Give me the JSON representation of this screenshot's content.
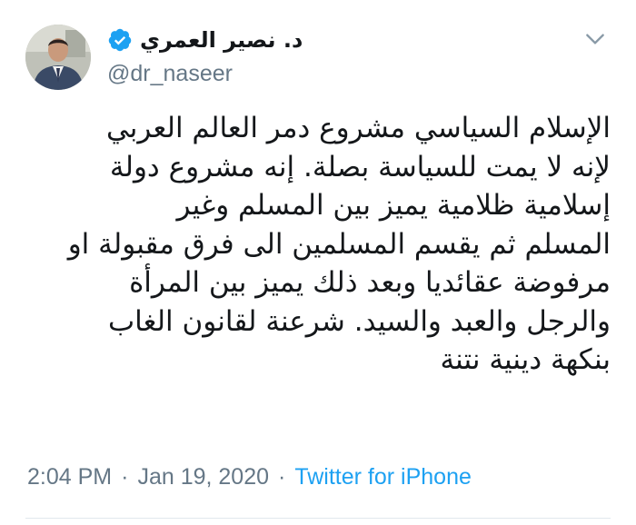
{
  "author": {
    "display_name": "د. نصير العمري",
    "handle": "@dr_naseer",
    "verified": true
  },
  "tweet": {
    "lines": [
      "الإسلام السياسي مشروع دمر العالم العربي",
      "لإنه لا يمت للسياسة بصلة. إنه مشروع دولة",
      "إسلامية ظلامية يميز بين المسلم وغير",
      "المسلم ثم يقسم المسلمين الى فرق مقبولة او",
      "مرفوضة عقائديا وبعد ذلك يميز بين المرأة",
      "والرجل والعبد والسيد. شرعنة لقانون الغاب",
      "بنكهة دينية نتنة"
    ]
  },
  "meta": {
    "time": "2:04 PM",
    "separator": "·",
    "date": "Jan 19, 2020",
    "source": "Twitter for iPhone"
  },
  "icons": {
    "verified": "verified-badge-icon",
    "menu": "chevron-down-icon"
  },
  "colors": {
    "text": "#14171a",
    "secondary": "#657786",
    "accent": "#1da1f2",
    "divider": "#e1e8ed"
  }
}
